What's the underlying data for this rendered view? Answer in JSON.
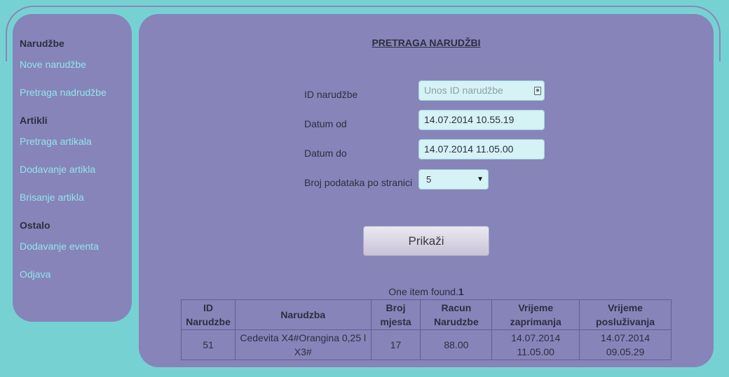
{
  "sidebar": {
    "sections": [
      {
        "heading": "Narudžbe",
        "links": [
          "Nove narudžbe",
          "Pretraga nadrudžbe"
        ]
      },
      {
        "heading": "Artikli",
        "links": [
          "Pretraga artikala",
          "Dodavanje artikla",
          "Brisanje artikla"
        ]
      },
      {
        "heading": "Ostalo",
        "links": [
          "Dodavanje eventa",
          "Odjava"
        ]
      }
    ]
  },
  "main": {
    "title": "PRETRAGA NARUDŽBI",
    "form": {
      "id_label": "ID narudžbe",
      "id_placeholder": "Unos ID narudžbe",
      "date_from_label": "Datum od",
      "date_from_value": "14.07.2014 10.55.19",
      "date_to_label": "Datum do",
      "date_to_value": "14.07.2014 11.05.00",
      "per_page_label": "Broj podataka po stranici",
      "per_page_value": "5"
    },
    "submit_label": "Prikaži",
    "found_text": "One item found.",
    "found_count": "1",
    "table": {
      "headers": [
        "ID Narudzbe",
        "Narudzba",
        "Broj mjesta",
        "Racun Narudzbe",
        "Vrijeme zaprimanja",
        "Vrijeme posluživanja"
      ],
      "rows": [
        [
          "51",
          "Cedevita X4#Orangina 0,25 l X3#",
          "17",
          "88.00",
          "14.07.2014 11.05.00",
          "14.07.2014 09.05.29"
        ]
      ]
    }
  },
  "colors": {
    "background": "#76d2d2",
    "panel": "#8784ba",
    "link": "#8fe6ea",
    "input_bg": "#d5f2f5"
  }
}
